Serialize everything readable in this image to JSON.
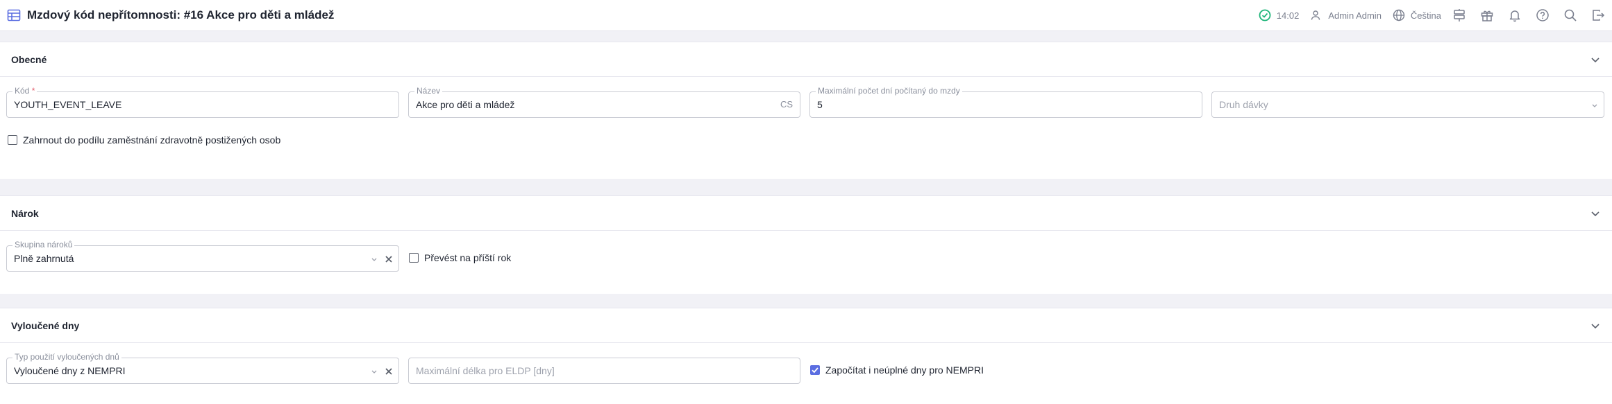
{
  "header": {
    "title": "Mzdový kód nepřítomnosti: #16 Akce pro děti a mládež",
    "time": "14:02",
    "user": "Admin Admin",
    "language": "Čeština"
  },
  "sections": {
    "general": {
      "title": "Obecné",
      "code": {
        "label": "Kód",
        "required_mark": "*",
        "value": "YOUTH_EVENT_LEAVE"
      },
      "name": {
        "label": "Název",
        "value": "Akce pro děti a mládež",
        "suffix": "CS"
      },
      "max_days": {
        "label": "Maximální počet dní počítaný do mzdy",
        "value": "5"
      },
      "benefit_type": {
        "placeholder": "Druh dávky"
      },
      "include_disabled": {
        "label": "Zahrnout do podílu zaměstnání zdravotně postižených osob",
        "checked": false
      }
    },
    "entitlement": {
      "title": "Nárok",
      "group": {
        "label": "Skupina nároků",
        "value": "Plně zahrnutá"
      },
      "transfer": {
        "label": "Převést na příští rok",
        "checked": false
      }
    },
    "excluded": {
      "title": "Vyloučené dny",
      "usage_type": {
        "label": "Typ použití vyloučených dnů",
        "value": "Vyloučené dny z NEMPRI"
      },
      "max_length": {
        "placeholder": "Maximální délka pro ELDP [dny]"
      },
      "count_partial": {
        "label": "Započítat i neúplné dny pro NEMPRI",
        "checked": true
      }
    }
  },
  "colors": {
    "accent": "#5b6ee1",
    "success": "#1fb57a",
    "muted": "#7a7f8e"
  }
}
